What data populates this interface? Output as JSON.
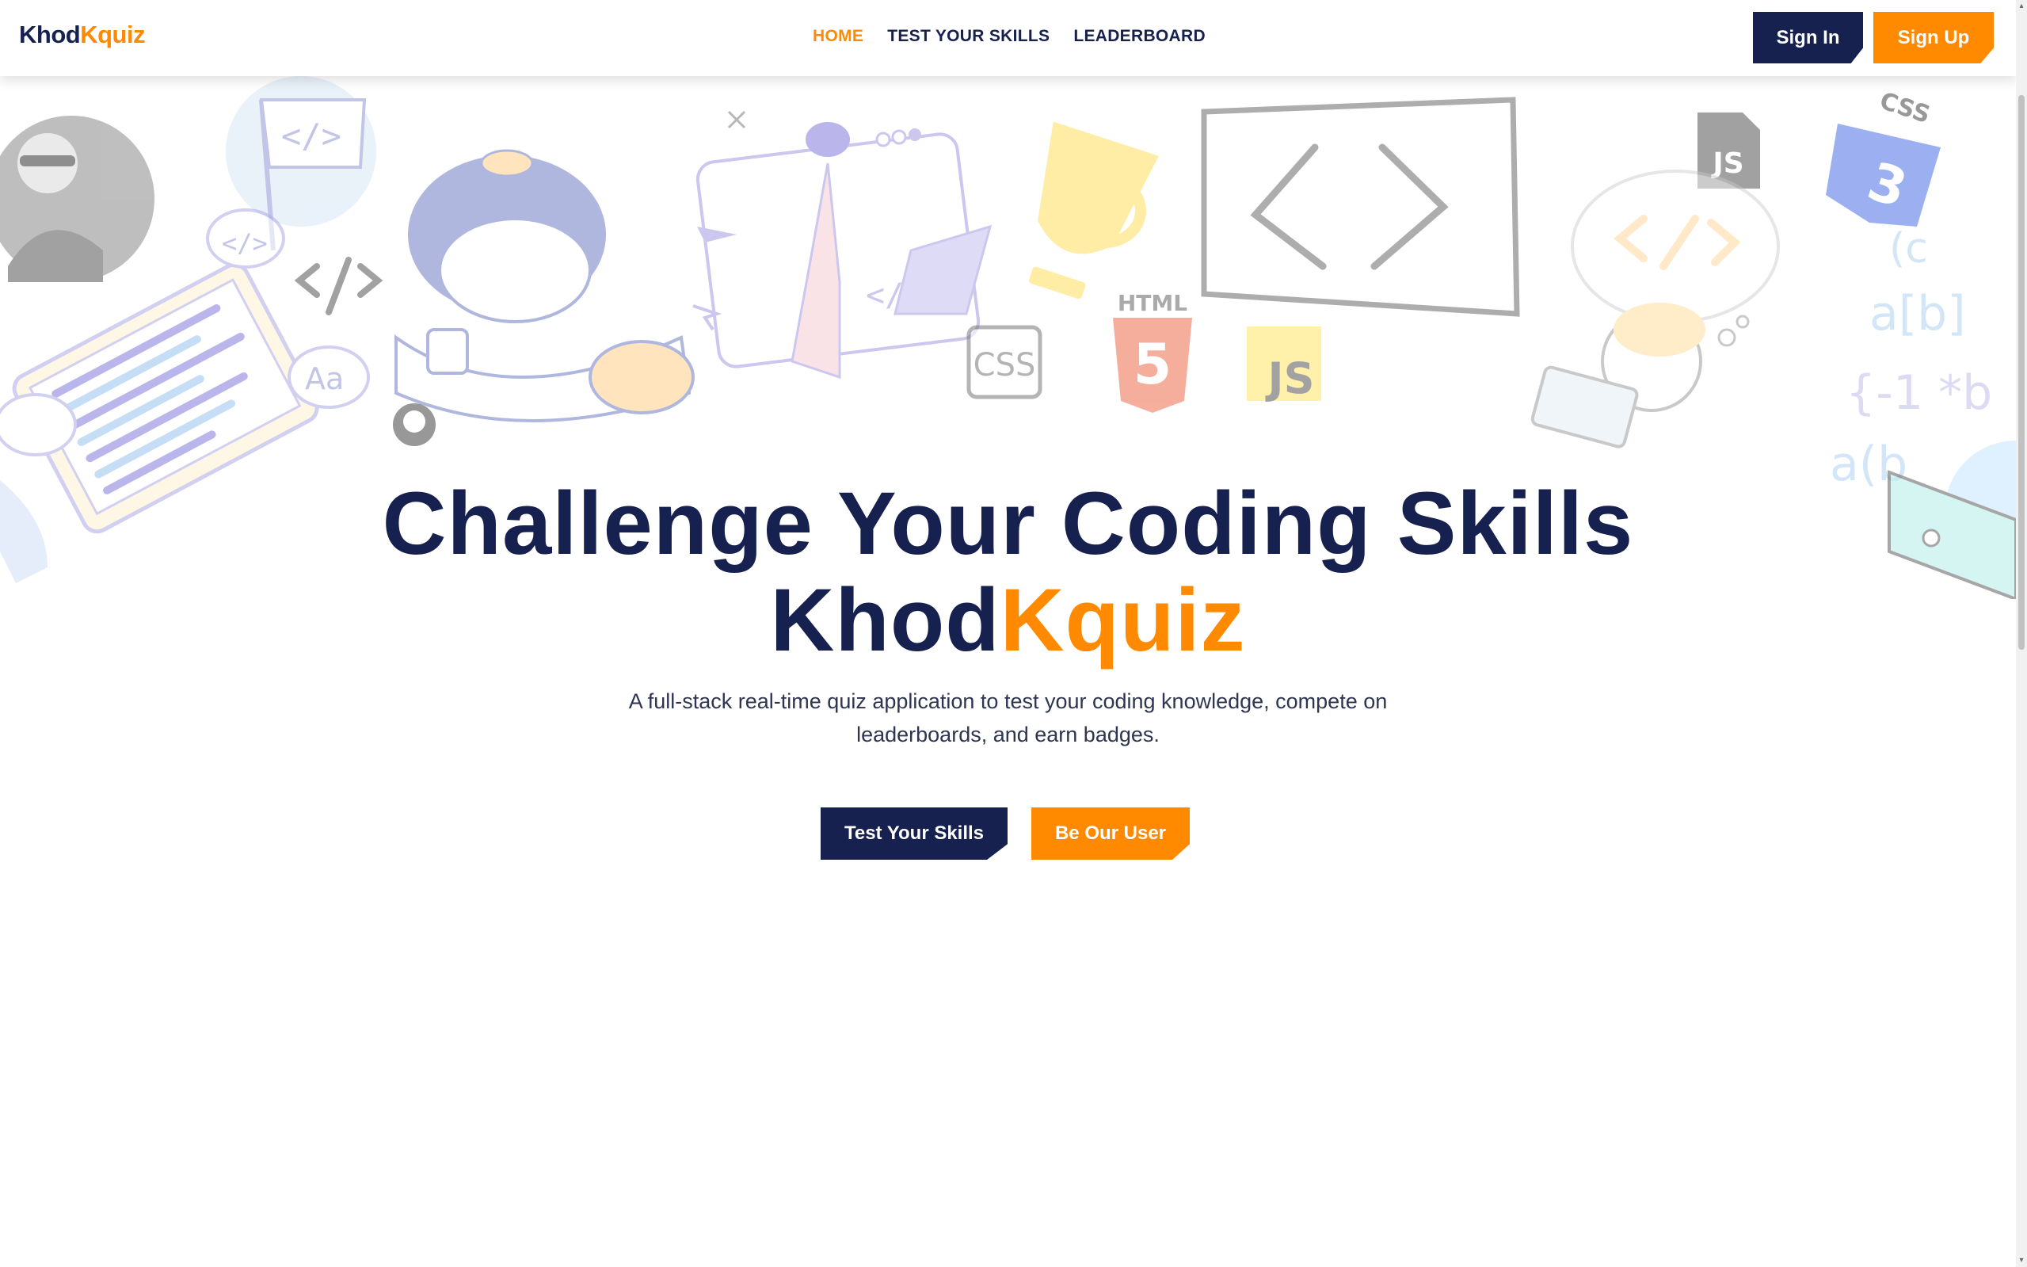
{
  "brand": {
    "name_part1": "Khod",
    "name_part2": "Kquiz"
  },
  "nav": {
    "links": [
      {
        "label": "HOME",
        "active": true
      },
      {
        "label": "TEST YOUR SKILLS",
        "active": false
      },
      {
        "label": "LEADERBOARD",
        "active": false
      }
    ],
    "signin_label": "Sign In",
    "signup_label": "Sign Up"
  },
  "hero": {
    "title_line1": "Challenge Your Coding Skills",
    "title_line2_part1": "Khod",
    "title_line2_part2": "Kquiz",
    "subtitle": "A full-stack real-time quiz application to test your coding knowledge, compete on leaderboards, and earn badges.",
    "cta_primary": "Test Your Skills",
    "cta_secondary": "Be Our User"
  },
  "illustrations": {
    "css_badge": "CSS",
    "html_badge": "HTML",
    "html_shield": "5",
    "js_badge_yellow": "JS",
    "js_badge_file": "JS",
    "css3_badge": "CSS",
    "code_tag": "</>",
    "speech_aa": "Aa"
  },
  "colors": {
    "navy": "#16214f",
    "orange": "#ff8a00",
    "purple": "#a9a3e6",
    "gray": "#a8a8a8"
  }
}
